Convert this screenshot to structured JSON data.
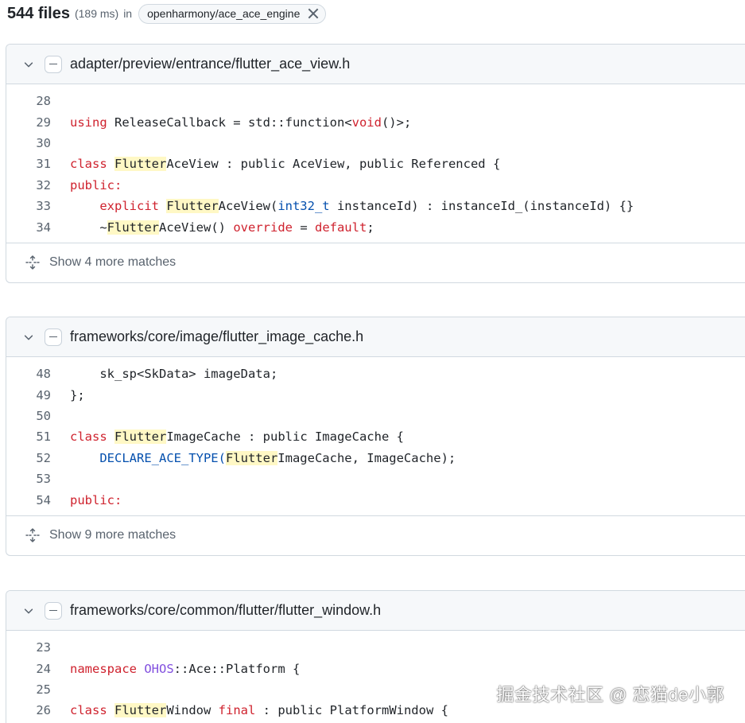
{
  "search": {
    "count": "544 files",
    "time": "(189 ms)",
    "in_label": "in",
    "repo": "openharmony/ace_ace_engine"
  },
  "results": [
    {
      "path": "adapter/preview/entrance/flutter_ace_view.h",
      "more": "Show 4 more matches",
      "lines": [
        {
          "n": "28"
        },
        {
          "n": "29"
        },
        {
          "n": "30"
        },
        {
          "n": "31"
        },
        {
          "n": "32"
        },
        {
          "n": "33"
        },
        {
          "n": "34"
        }
      ]
    },
    {
      "path": "frameworks/core/image/flutter_image_cache.h",
      "more": "Show 9 more matches",
      "lines": [
        {
          "n": "48"
        },
        {
          "n": "49"
        },
        {
          "n": "50"
        },
        {
          "n": "51"
        },
        {
          "n": "52"
        },
        {
          "n": "53"
        },
        {
          "n": "54"
        }
      ]
    },
    {
      "path": "frameworks/core/common/flutter/flutter_window.h",
      "lines": [
        {
          "n": "23"
        },
        {
          "n": "24"
        },
        {
          "n": "25"
        },
        {
          "n": "26"
        }
      ]
    }
  ],
  "code": {
    "r0l29": {
      "a": "using",
      "b": " ReleaseCallback = std::function<",
      "c": "void",
      "d": "()>;"
    },
    "r0l31": {
      "a": "class",
      "b": " ",
      "c": "Flutter",
      "d": "AceView : public AceView, public Referenced {"
    },
    "r0l32": {
      "a": "public:"
    },
    "r0l33": {
      "a": "    ",
      "b": "explicit",
      "c": " ",
      "d": "Flutter",
      "e": "AceView(",
      "f": "int32_t",
      "g": " instanceId) : instanceId_(instanceId) {}"
    },
    "r0l34": {
      "a": "    ~",
      "b": "Flutter",
      "c": "AceView() ",
      "d": "override",
      "e": " = ",
      "f": "default",
      "g": ";"
    },
    "r1l48": {
      "a": "    sk_sp<SkData> imageData;"
    },
    "r1l49": {
      "a": "};"
    },
    "r1l51": {
      "a": "class",
      "b": " ",
      "c": "Flutter",
      "d": "ImageCache : public ImageCache {"
    },
    "r1l52": {
      "a": "    ",
      "b": "DECLARE_ACE_TYPE(",
      "c": "Flutter",
      "d": "ImageCache, ImageCache);"
    },
    "r1l54": {
      "a": "public:"
    },
    "r2l24": {
      "a": "namespace",
      "b": " ",
      "c": "OHOS",
      "d": "::Ace::Platform {"
    },
    "r2l26": {
      "a": "class",
      "b": " ",
      "c": "Flutter",
      "d": "Window ",
      "e": "final",
      "f": " : public PlatformWindow {"
    }
  },
  "watermark": "掘金技术社区 @ 恋猫de小郭",
  "colors": {
    "keyword": "#cf222e",
    "type": "#0550ae",
    "namespace": "#8250df",
    "match_highlight": "#fff8c5",
    "header_bg": "#f6f8fa",
    "border": "#d1d9e0"
  }
}
